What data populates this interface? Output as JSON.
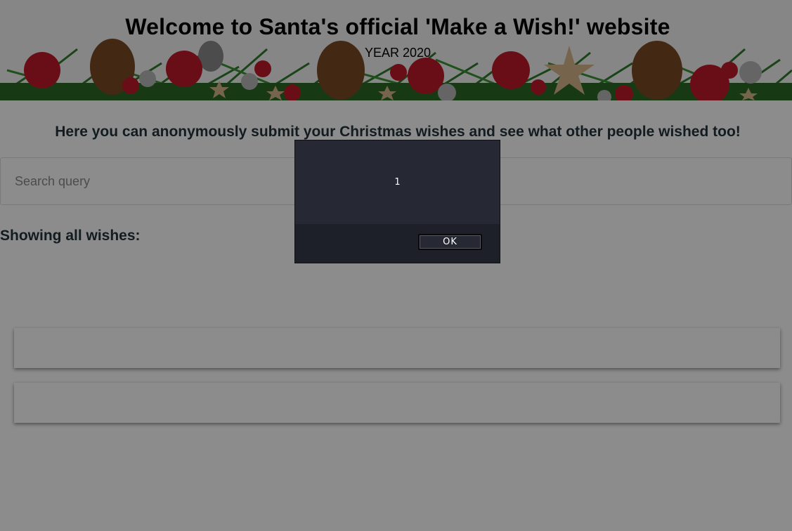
{
  "header": {
    "title": "Welcome to Santa's official 'Make a Wish!' website",
    "subtitle": "YEAR 2020"
  },
  "main": {
    "intro": "Here you can anonymously submit your Christmas wishes and see what other people wished too!",
    "search": {
      "placeholder": "Search query",
      "value": ""
    },
    "wishes_heading": "Showing all wishes:",
    "wishes": [
      "",
      ""
    ]
  },
  "alert": {
    "message": "1",
    "ok_label": "OK"
  },
  "colors": {
    "overlay": "#000000",
    "dialog_bg": "#262833",
    "dialog_footer": "#1e2029",
    "heading_text": "#24333b",
    "ornament_red": "#c0192b",
    "pinecone_brown": "#7a4a24",
    "pine_green": "#2f7d2a"
  },
  "icons": [
    "ornament-icon",
    "pinecone-icon",
    "star-icon",
    "pine-branch-icon"
  ]
}
